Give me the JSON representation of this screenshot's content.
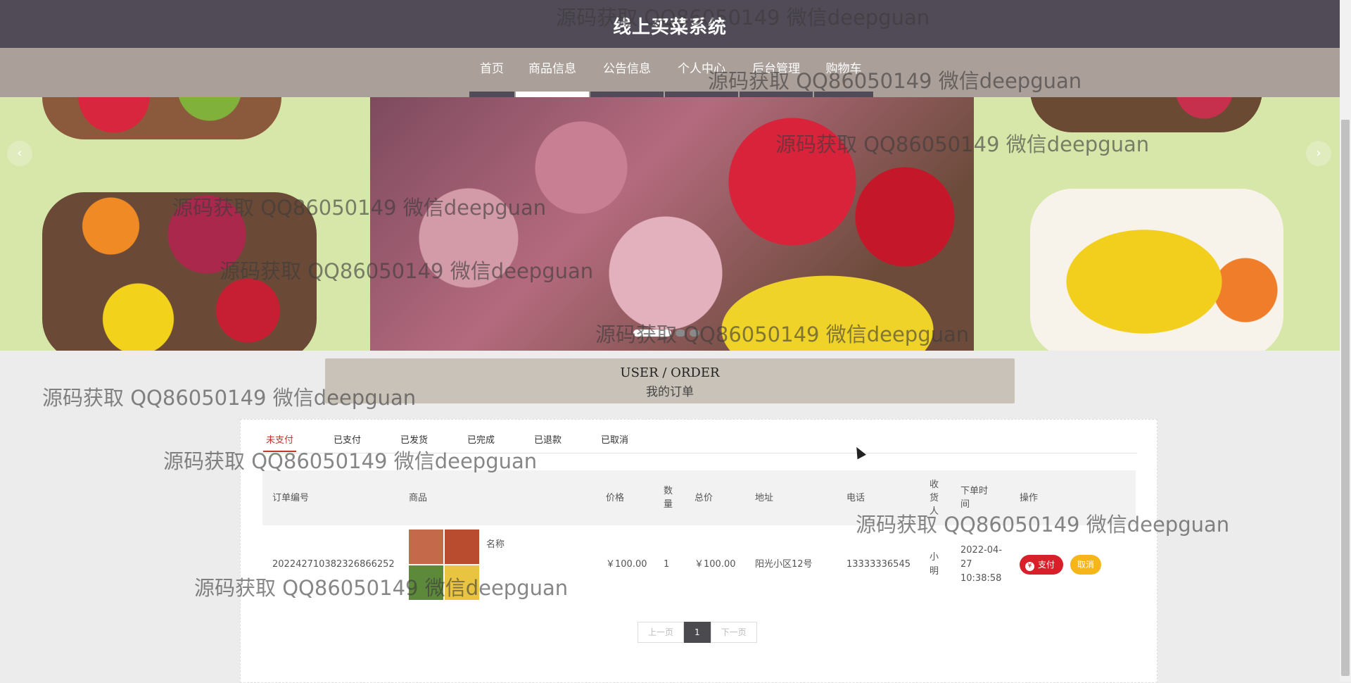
{
  "header": {
    "title": "线上买菜系统"
  },
  "nav": {
    "items": [
      {
        "label": "首页",
        "active": false,
        "width": 64
      },
      {
        "label": "商品信息",
        "active": true,
        "width": 104
      },
      {
        "label": "公告信息",
        "active": false,
        "width": 104
      },
      {
        "label": "个人中心",
        "active": false,
        "width": 104
      },
      {
        "label": "后台管理",
        "active": false,
        "width": 104
      },
      {
        "label": "购物车",
        "active": false,
        "width": 84
      }
    ]
  },
  "section": {
    "title_en": "USER / ORDER",
    "title_zh": "我的订单"
  },
  "tabs": [
    "未支付",
    "已支付",
    "已发货",
    "已完成",
    "已退款",
    "已取消"
  ],
  "active_tab": "未支付",
  "table": {
    "headers": {
      "order_no": "订单编号",
      "product": "商品",
      "price": "价格",
      "qty": "数量",
      "total": "总价",
      "address": "地址",
      "phone": "电话",
      "receiver": "收货人",
      "time": "下单时间",
      "actions": "操作"
    },
    "rows": [
      {
        "order_no": "2022427103823268662​52",
        "product_name": "名称",
        "price": "￥100.00",
        "qty": "1",
        "total": "￥100.00",
        "address": "阳光小区12号",
        "phone": "13333336545",
        "receiver": "小明",
        "time": "2022-04-27 10:38:58",
        "pay_label": "支付",
        "cancel_label": "取消"
      }
    ]
  },
  "pager": {
    "prev": "上一页",
    "current": "1",
    "next": "下一页"
  },
  "watermark_text": "源码获取 QQ86050149 微信deepguan"
}
